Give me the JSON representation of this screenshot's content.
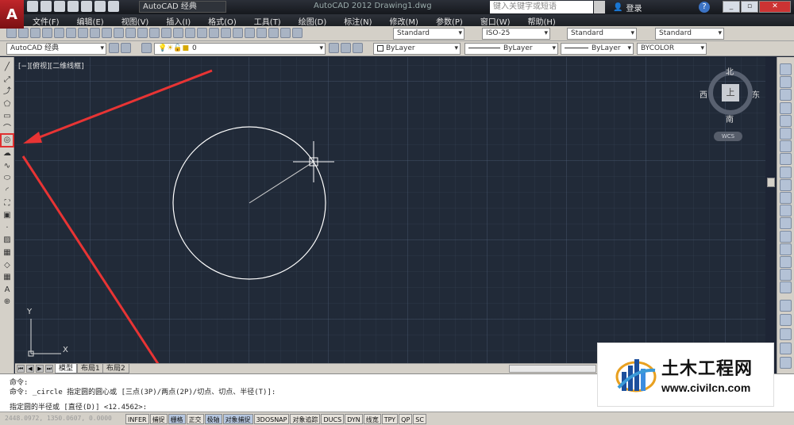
{
  "titlebar": {
    "logo": "A",
    "workspace": "AutoCAD 经典",
    "title": "AutoCAD 2012   Drawing1.dwg",
    "search_placeholder": "键入关键字或短语",
    "login": "登录",
    "help": "?"
  },
  "menu": [
    "文件(F)",
    "编辑(E)",
    "视图(V)",
    "插入(I)",
    "格式(O)",
    "工具(T)",
    "绘图(D)",
    "标注(N)",
    "修改(M)",
    "参数(P)",
    "窗口(W)",
    "帮助(H)"
  ],
  "styles": {
    "text_style": "Standard",
    "dim_style": "ISO-25",
    "table_style": "Standard",
    "multileader_style": "Standard"
  },
  "toolbar2": {
    "workspace": "AutoCAD 经典",
    "layer": "0",
    "color": "ByLayer",
    "linetype": "ByLayer",
    "lineweight": "ByLayer",
    "plotstyle": "BYCOLOR"
  },
  "viewport": {
    "label": "[−][俯视][二维线框]"
  },
  "viewcube": {
    "north": "北",
    "south": "南",
    "east": "东",
    "west": "西",
    "face": "上",
    "wcs": "WCS"
  },
  "ucs": {
    "x": "X",
    "y": "Y"
  },
  "tabs": [
    "模型",
    "布局1",
    "布局2"
  ],
  "command": {
    "line1": "命令:",
    "line2": "命令: _circle 指定圆的圆心或 [三点(3P)/两点(2P)/切点、切点、半径(T)]:",
    "line3": "指定圆的半径或 [直径(D)] <12.4562>:"
  },
  "status": {
    "coords": "2448.0972, 1350.0607, 0.0000",
    "buttons": [
      "INFER",
      "捕捉",
      "栅格",
      "正交",
      "极轴",
      "对象捕捉",
      "3DOSNAP",
      "对象追踪",
      "DUCS",
      "DYN",
      "线宽",
      "TPY",
      "QP",
      "SC"
    ],
    "on": [
      false,
      false,
      true,
      false,
      true,
      true,
      false,
      false,
      false,
      false,
      false,
      false,
      false,
      false
    ]
  },
  "watermark": {
    "title": "土木工程网",
    "url": "www.civilcn.com"
  },
  "colors": {
    "canvas": "#212a38",
    "circle": "#ffffff",
    "arrow": "#e83434"
  },
  "icons": {
    "left_tools": [
      "line-icon",
      "construction-line-icon",
      "polyline-icon",
      "polygon-icon",
      "rectangle-icon",
      "arc-icon",
      "circle-icon",
      "revision-cloud-icon",
      "spline-icon",
      "ellipse-icon",
      "ellipse-arc-icon",
      "insert-block-icon",
      "make-block-icon",
      "point-icon",
      "hatch-icon",
      "gradient-icon",
      "region-icon",
      "table-icon",
      "multiline-text-icon",
      "add-selected-icon"
    ]
  }
}
